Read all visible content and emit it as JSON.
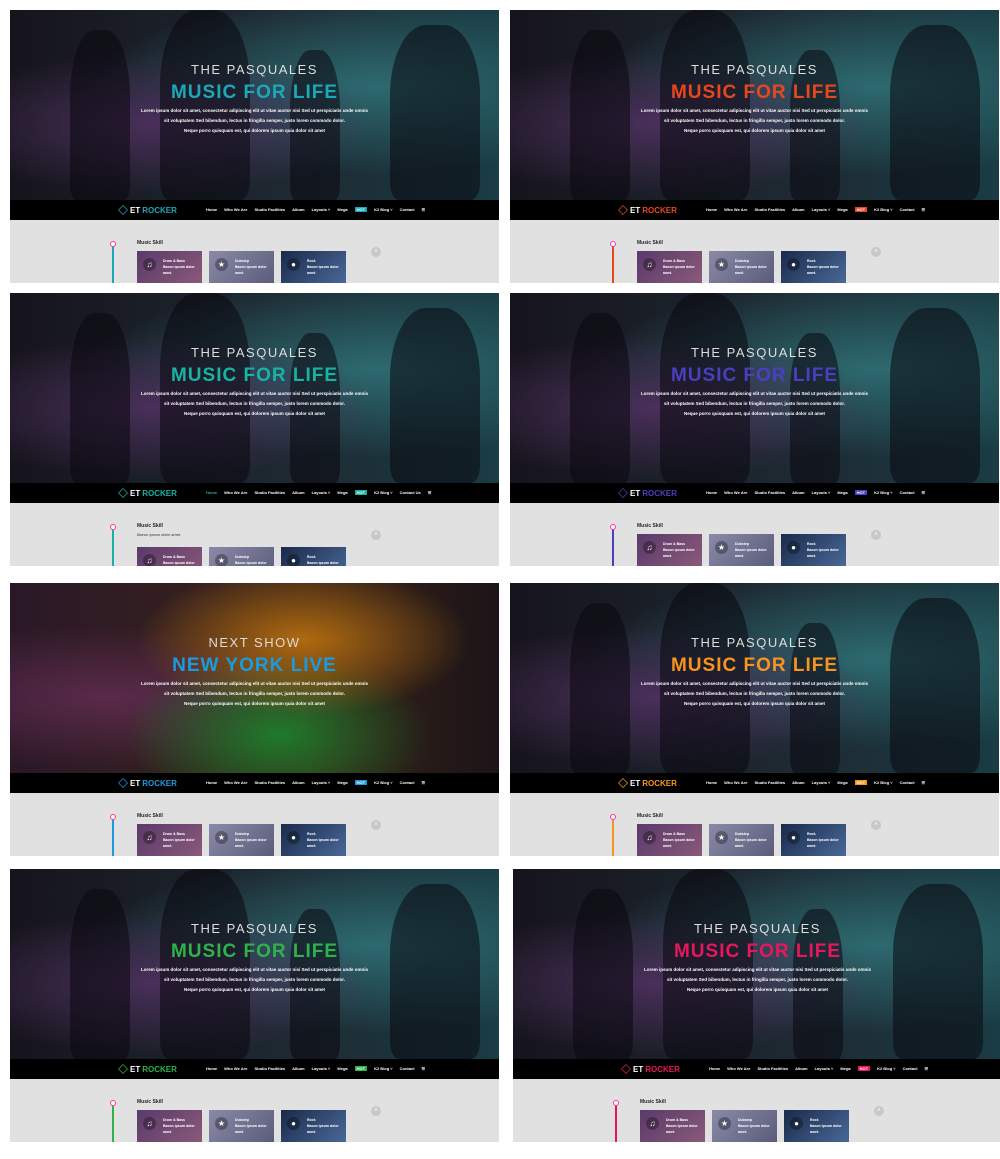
{
  "hero_text": "Lorem ipsum dolor sit amet, consectetur adipiscing elit ut vitae auctor nisi Sed ut perspiciatis unde omnis|sit voluptatem Sed bibendum, lectus in fringilla semper, justo lorem commodo dolor.|Neque porro quisquam est, qui dolorem ipsum quia dolor sit amet",
  "logo": {
    "prefix": "ET",
    "name": "ROCKER"
  },
  "menu": [
    "Home",
    "Who We Are",
    "Studio Facilities",
    "Album",
    "Layouts ˅",
    "Mega",
    "K2 Blog ˅",
    "Contact"
  ],
  "mega_badge": "HOT",
  "section_title": "Music Skill",
  "section_sub": "Bacon ipsum dolor amet.",
  "cards": [
    {
      "title": "Drum & Bass",
      "icon": "music-note-icon",
      "glyph": "♫",
      "text": "Bacon ipsum dolor amet."
    },
    {
      "title": "Dubstep",
      "icon": "star-icon",
      "glyph": "★",
      "text": "Bacon ipsum dolor amet."
    },
    {
      "title": "Rock",
      "icon": "circle-icon",
      "glyph": "●",
      "text": "Bacon ipsum dolor amet."
    }
  ],
  "panels": [
    {
      "kicker": "THE PASQUALES",
      "headline": "MUSIC FOR LIFE",
      "accent": "#1aa9b8"
    },
    {
      "kicker": "THE PASQUALES",
      "headline": "MUSIC FOR LIFE",
      "accent": "#e8461e"
    },
    {
      "kicker": "THE PASQUALES",
      "headline": "MUSIC FOR LIFE",
      "accent": "#17b3a3",
      "home_active": true,
      "contact_label": "Contact Us",
      "show_sub": true
    },
    {
      "kicker": "THE PASQUALES",
      "headline": "MUSIC FOR LIFE",
      "accent": "#4a3fc0"
    },
    {
      "kicker": "NEXT SHOW",
      "headline": "NEW YORK LIVE",
      "accent": "#1a9be0",
      "alt_bg": true
    },
    {
      "kicker": "THE PASQUALES",
      "headline": "MUSIC FOR LIFE",
      "accent": "#f7941d"
    },
    {
      "kicker": "THE PASQUALES",
      "headline": "MUSIC FOR LIFE",
      "accent": "#2db34a"
    },
    {
      "kicker": "THE PASQUALES",
      "headline": "MUSIC FOR LIFE",
      "accent": "#e8175d"
    }
  ]
}
